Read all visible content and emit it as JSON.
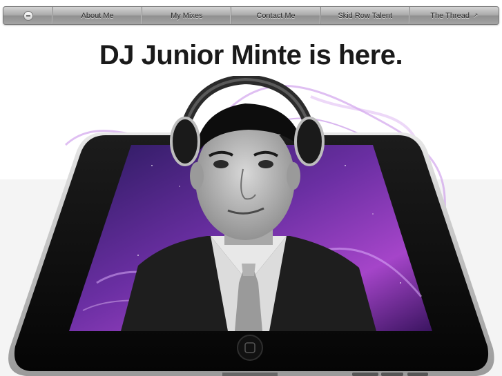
{
  "nav": {
    "logo_icon": "logo-icon",
    "items": [
      {
        "label": "About Me"
      },
      {
        "label": "My Mixes"
      },
      {
        "label": "Contact Me"
      },
      {
        "label": "Skid Row Talent"
      },
      {
        "label": "The Thread",
        "icon": "external-link-icon"
      }
    ]
  },
  "headline": "DJ Junior Minte is here.",
  "hero": {
    "subject": "dj-headphones-portrait",
    "device": "tablet",
    "accent_color": "#8a2be2"
  }
}
